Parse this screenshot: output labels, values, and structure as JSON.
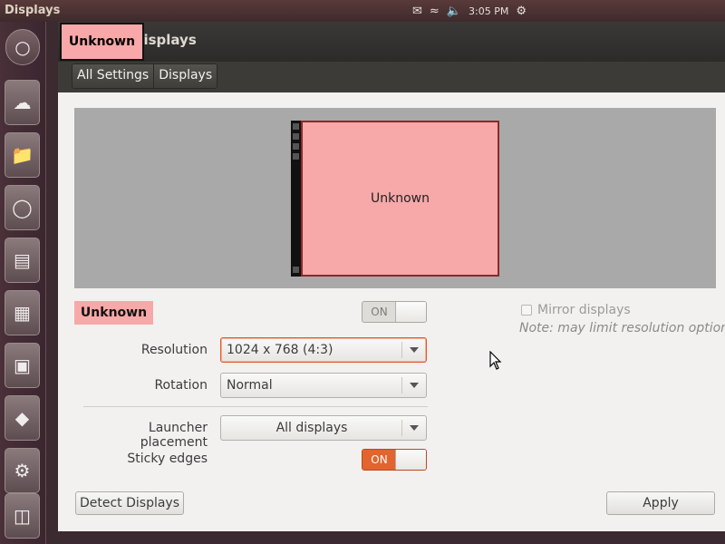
{
  "panel": {
    "app_title": "Displays",
    "clock": "3:05 PM"
  },
  "window": {
    "title": "Displays",
    "highlight_label": "Unknown",
    "breadcrumbs": [
      "All Settings",
      "Displays"
    ]
  },
  "arrangement": {
    "monitor_label": "Unknown"
  },
  "display": {
    "name": "Unknown",
    "power_toggle": "ON",
    "power_on": true
  },
  "mirror": {
    "label": "Mirror displays",
    "checked": false,
    "note": "Note: may limit resolution options"
  },
  "settings": {
    "resolution_label": "Resolution",
    "resolution_value": "1024 x 768 (4:3)",
    "rotation_label": "Rotation",
    "rotation_value": "Normal",
    "launcher_label": "Launcher placement",
    "launcher_value": "All displays",
    "sticky_label": "Sticky edges",
    "sticky_value": "ON",
    "sticky_on": true
  },
  "buttons": {
    "detect": "Detect Displays",
    "apply": "Apply"
  },
  "colors": {
    "accent": "#e2642e",
    "highlight": "#f7a8a8"
  }
}
